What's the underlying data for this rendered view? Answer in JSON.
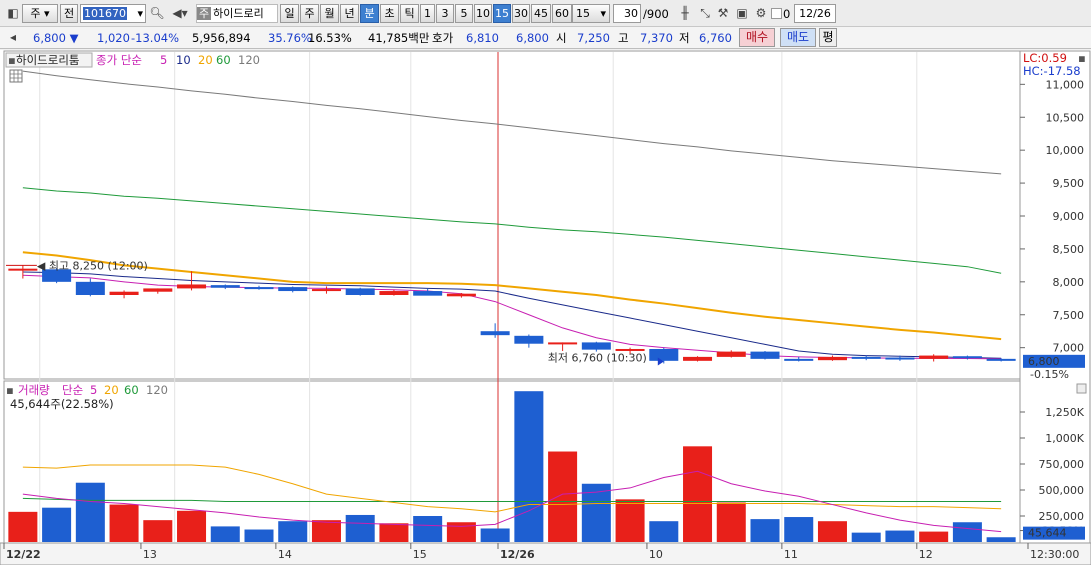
{
  "toolbar": {
    "market_select": "주",
    "prefix_select": "전",
    "stock_code": "101670",
    "stock_tag": "주",
    "stock_name": "하이드로리",
    "period_day": "일",
    "period_week": "주",
    "period_month": "월",
    "period_year": "년",
    "period_minute": "분",
    "period_second": "초",
    "period_tick": "틱",
    "intervals": [
      "1",
      "3",
      "5",
      "10",
      "15",
      "30",
      "45",
      "60"
    ],
    "selected_interval": "15",
    "interval_select": "15",
    "count": "30",
    "count_total": "/900",
    "checkbox_label": "0",
    "date": "12/26"
  },
  "quote": {
    "price": "6,800",
    "change": "1,020",
    "change_pct": "-13.04%",
    "volume": "5,956,894",
    "vol_ratio": "35.76%",
    "turnover": "16.53%",
    "amount": "41,785백만",
    "bid_label": "호가",
    "bid": "6,810",
    "ask": "6,800",
    "open_label": "시",
    "open": "7,250",
    "high_label": "고",
    "high": "7,370",
    "low_label": "저",
    "low": "6,760",
    "buy_button": "매수",
    "sell_button": "매도",
    "eval_button": "평"
  },
  "price_legend": {
    "title": "하이드로리툼",
    "ma_label": "종가 단순",
    "ma_periods": [
      "5",
      "10",
      "20",
      "60",
      "120"
    ],
    "lc": "LC:0.59",
    "hc": "HC:-17.58"
  },
  "volume_legend": {
    "title": "거래량",
    "ma_label": "단순",
    "ma_periods": [
      "5",
      "20",
      "60",
      "120"
    ],
    "current": "45,644주(22.58%)"
  },
  "annotations": {
    "high": "최고 8,250 (12:00)",
    "low": "최저 6,760 (10:30)"
  },
  "colors": {
    "up": "#e8201a",
    "down": "#1e5fd1",
    "ma5": "#c71fb2",
    "ma10": "#1a2a8a",
    "ma20": "#f0a500",
    "ma60": "#1f9a3a",
    "ma120": "#7a7a7a"
  },
  "x_labels": [
    "12/22",
    "13",
    "14",
    "15",
    "12/26",
    "10",
    "11",
    "12",
    "12:30:00"
  ],
  "price_axis": [
    "11,000",
    "10,500",
    "10,000",
    "9,500",
    "9,000",
    "8,500",
    "8,000",
    "7,500",
    "7,000"
  ],
  "price_current": "6,800",
  "price_current_pct": "-0.15%",
  "volume_axis": [
    "1,250K",
    "1,000K",
    "750,000",
    "500,000",
    "250,000",
    "22.58%"
  ],
  "volume_current": "45,644",
  "chart_data": {
    "type": "candlestick",
    "ohlc": [
      {
        "o": 8200,
        "h": 8250,
        "l": 8050,
        "c": 8200
      },
      {
        "o": 8190,
        "h": 8210,
        "l": 7980,
        "c": 8000
      },
      {
        "o": 8000,
        "h": 8050,
        "l": 7780,
        "c": 7800
      },
      {
        "o": 7800,
        "h": 7870,
        "l": 7750,
        "c": 7850
      },
      {
        "o": 7850,
        "h": 7900,
        "l": 7820,
        "c": 7900
      },
      {
        "o": 7900,
        "h": 8160,
        "l": 7870,
        "c": 7960
      },
      {
        "o": 7950,
        "h": 7960,
        "l": 7890,
        "c": 7910
      },
      {
        "o": 7920,
        "h": 7940,
        "l": 7880,
        "c": 7900
      },
      {
        "o": 7920,
        "h": 7930,
        "l": 7840,
        "c": 7860
      },
      {
        "o": 7870,
        "h": 7930,
        "l": 7820,
        "c": 7890
      },
      {
        "o": 7900,
        "h": 7910,
        "l": 7790,
        "c": 7800
      },
      {
        "o": 7800,
        "h": 7880,
        "l": 7790,
        "c": 7860
      },
      {
        "o": 7860,
        "h": 7900,
        "l": 7800,
        "c": 7790
      },
      {
        "o": 7780,
        "h": 7830,
        "l": 7760,
        "c": 7820
      },
      {
        "o": 7250,
        "h": 7370,
        "l": 7150,
        "c": 7190
      },
      {
        "o": 7180,
        "h": 7200,
        "l": 7000,
        "c": 7060
      },
      {
        "o": 7060,
        "h": 7080,
        "l": 6950,
        "c": 7080
      },
      {
        "o": 7080,
        "h": 7090,
        "l": 6940,
        "c": 6970
      },
      {
        "o": 6980,
        "h": 7000,
        "l": 6900,
        "c": 6980
      },
      {
        "o": 6980,
        "h": 7000,
        "l": 6760,
        "c": 6800
      },
      {
        "o": 6800,
        "h": 6870,
        "l": 6790,
        "c": 6860
      },
      {
        "o": 6860,
        "h": 6960,
        "l": 6850,
        "c": 6940
      },
      {
        "o": 6940,
        "h": 6950,
        "l": 6820,
        "c": 6830
      },
      {
        "o": 6830,
        "h": 6860,
        "l": 6790,
        "c": 6810
      },
      {
        "o": 6810,
        "h": 6880,
        "l": 6800,
        "c": 6860
      },
      {
        "o": 6860,
        "h": 6880,
        "l": 6810,
        "c": 6850
      },
      {
        "o": 6850,
        "h": 6880,
        "l": 6800,
        "c": 6830
      },
      {
        "o": 6830,
        "h": 6900,
        "l": 6790,
        "c": 6880
      },
      {
        "o": 6870,
        "h": 6880,
        "l": 6820,
        "c": 6840
      },
      {
        "o": 6830,
        "h": 6840,
        "l": 6790,
        "c": 6800
      }
    ],
    "volume": [
      290000,
      330000,
      570000,
      360000,
      210000,
      300000,
      150000,
      120000,
      200000,
      210000,
      260000,
      180000,
      250000,
      190000,
      130000,
      1450000,
      870000,
      560000,
      410000,
      200000,
      920000,
      380000,
      220000,
      240000,
      200000,
      90000,
      110000,
      100000,
      190000,
      45644
    ],
    "ma5": [
      8100,
      8080,
      8060,
      8000,
      7950,
      7930,
      7920,
      7910,
      7905,
      7900,
      7890,
      7880,
      7860,
      7820,
      7700,
      7500,
      7300,
      7150,
      7050,
      7000,
      6960,
      6920,
      6880,
      6860,
      6850,
      6845,
      6840,
      6838,
      6835,
      6830
    ],
    "ma10": [
      8150,
      8140,
      8120,
      8080,
      8050,
      8020,
      8000,
      7980,
      7960,
      7950,
      7940,
      7920,
      7900,
      7890,
      7860,
      7750,
      7650,
      7550,
      7450,
      7350,
      7250,
      7150,
      7050,
      6950,
      6900,
      6880,
      6870,
      6860,
      6850,
      6840
    ],
    "ma20": [
      8450,
      8400,
      8330,
      8250,
      8200,
      8150,
      8100,
      8050,
      8000,
      7980,
      7980,
      7980,
      7980,
      7970,
      7950,
      7900,
      7850,
      7800,
      7730,
      7670,
      7600,
      7530,
      7470,
      7420,
      7370,
      7320,
      7270,
      7230,
      7180,
      7130
    ],
    "ma60": [
      9430,
      9380,
      9350,
      9300,
      9270,
      9230,
      9190,
      9150,
      9110,
      9070,
      9030,
      8990,
      8950,
      8910,
      8880,
      8830,
      8790,
      8760,
      8720,
      8680,
      8630,
      8580,
      8530,
      8480,
      8430,
      8380,
      8330,
      8280,
      8230,
      8130
    ],
    "ma120": [
      11200,
      11130,
      11070,
      11010,
      10960,
      10900,
      10850,
      10790,
      10740,
      10680,
      10630,
      10570,
      10510,
      10450,
      10400,
      10340,
      10280,
      10220,
      10160,
      10100,
      10050,
      9990,
      9940,
      9890,
      9840,
      9800,
      9760,
      9720,
      9680,
      9640
    ],
    "vol_ma5": [
      460000,
      420000,
      390000,
      370000,
      340000,
      310000,
      280000,
      240000,
      210000,
      190000,
      180000,
      170000,
      160000,
      150000,
      170000,
      300000,
      460000,
      480000,
      520000,
      620000,
      680000,
      560000,
      490000,
      440000,
      360000,
      280000,
      210000,
      160000,
      130000,
      100000
    ],
    "vol_ma20": [
      720000,
      710000,
      740000,
      740000,
      740000,
      740000,
      720000,
      650000,
      560000,
      460000,
      420000,
      380000,
      340000,
      320000,
      290000,
      360000,
      360000,
      370000,
      370000,
      370000,
      370000,
      370000,
      370000,
      370000,
      360000,
      350000,
      340000,
      340000,
      330000,
      320000
    ],
    "vol_ma60": [
      420000,
      410000,
      400000,
      400000,
      400000,
      400000,
      390000,
      390000,
      390000,
      390000,
      390000,
      390000,
      390000,
      390000,
      390000,
      390000,
      390000,
      390000,
      390000,
      390000,
      390000,
      390000,
      390000,
      390000,
      390000,
      390000,
      390000,
      390000,
      390000,
      390000
    ],
    "price_ylim": [
      6600,
      11400
    ],
    "volume_ylim": [
      0,
      1500000
    ]
  }
}
